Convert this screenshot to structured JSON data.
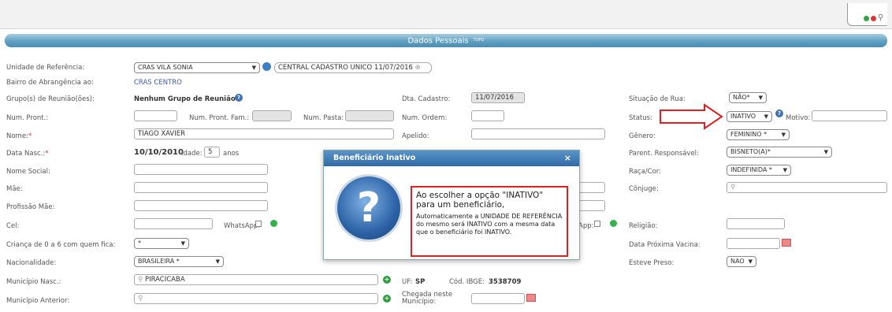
{
  "section": {
    "title": "Dados Pessoais",
    "topo": "TOPO"
  },
  "fields": {
    "unidade_label": "Unidade de Referência:",
    "unidade_value": "CRAS VILA SONIA",
    "central_value": "CENTRAL CADASTRO UNICO 11/07/2016",
    "bairro_label": "Bairro de Abrangência ao:",
    "bairro_value": "CRAS CENTRO",
    "grupo_label": "Grupo(s) de Reunião(ões):",
    "grupo_value": "Nenhum Grupo de Reunião",
    "dta_cadastro_label": "Dta. Cadastro:",
    "dta_cadastro_value": "11/07/2016",
    "situacao_rua_label": "Situação de Rua:",
    "situacao_rua_value": "NÃO*",
    "num_pront_label": "Num. Pront.:",
    "num_pront_fam_label": "Num. Pront. Fam.:",
    "num_pasta_label": "Num. Pasta:",
    "num_ordem_label": "Num. Ordem:",
    "status_label": "Status:",
    "status_value": "INATIVO",
    "motivo_label": "Motivo:",
    "nome_label": "Nome:",
    "nome_req": "*",
    "nome_value": "TIAGO XAVIER",
    "apelido_label": "Apelido:",
    "genero_label": "Gênero:",
    "genero_value": "FEMININO *",
    "data_nasc_label": "Data Nasc.:",
    "data_nasc_value": "10/10/2010",
    "idade_label": "Idade:",
    "idade_value": "5",
    "anos_label": "anos",
    "parent_label": "Parent. Responsável:",
    "parent_value": "BISNETO(A)*",
    "nome_social_label": "Nome Social:",
    "raca_label": "Raça/Cor:",
    "raca_value": "INDEFINIDA *",
    "mae_label": "Mãe:",
    "conjuge_label": "Cônjuge:",
    "profissao_mae_label": "Profissão Mãe:",
    "cel_label": "Cel:",
    "whatsapp_label": "WhatsApp:",
    "whatsapp2_label": "App:",
    "religiao_label": "Religião:",
    "crianca_label": "Criança de 0 a 6 com quem fica:",
    "crianca_value": "*",
    "data_vacina_label": "Data Próxima Vacina:",
    "nacionalidade_label": "Nacionalidade:",
    "nacionalidade_value": "BRASILEIRA *",
    "esteve_preso_label": "Esteve Preso:",
    "esteve_preso_value": "NAO",
    "municipio_nasc_label": "Município Nasc.:",
    "municipio_nasc_value": "PIRACICABA",
    "uf_label": "UF:",
    "uf_value": "SP",
    "ibge_label": "Cód. IBGE:",
    "ibge_value": "3538709",
    "municipio_ant_label": "Município Anterior:",
    "chegada_label": "Chegada neste Município:"
  },
  "modal": {
    "title": "Beneficiário Inativo",
    "close": "×",
    "icon_glyph": "?",
    "message_title": "Ao escolher a opção \"INATIVO\" para um beneficiário,",
    "message_body": "Automaticamente a UNIDADE DE REFERÊNCIA do mesmo será INATIVO com a mesma data que o beneficiário foi INATIVO."
  },
  "colors": {
    "accent": "#4b8db0",
    "annotation": "#e02020",
    "modal_header": "#2f6aa6"
  }
}
